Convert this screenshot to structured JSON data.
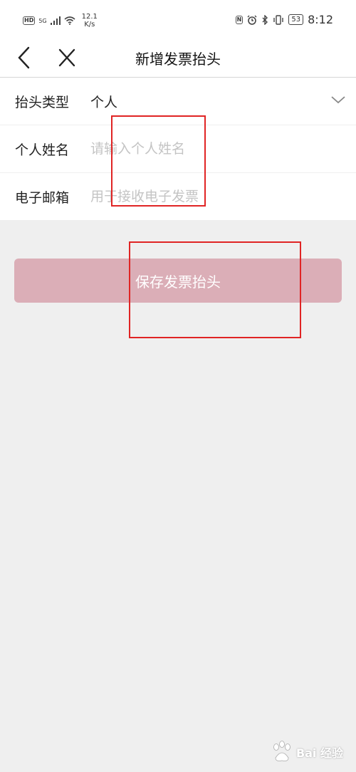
{
  "status_bar": {
    "hd": "HD",
    "network": "5G",
    "speed_value": "12.1",
    "speed_unit": "K/s",
    "nfc": "N",
    "battery": "53",
    "time": "8:12"
  },
  "nav": {
    "title": "新增发票抬头",
    "back_icon": "chevron-left-icon",
    "close_icon": "close-icon"
  },
  "form": {
    "rows": [
      {
        "label": "抬头类型",
        "value": "个人"
      },
      {
        "label": "个人姓名",
        "placeholder": "请输入个人姓名",
        "value": ""
      },
      {
        "label": "电子邮箱",
        "placeholder": "用于接收电子发票",
        "value": ""
      }
    ]
  },
  "save_button": {
    "label": "保存发票抬头",
    "color": "#dbaeb7"
  },
  "watermark": {
    "text": "Bai 经验",
    "icon": "baidu-paw-icon"
  },
  "colors": {
    "background": "#efefef",
    "annotation_red": "#e02424",
    "placeholder": "#c4c4c4"
  }
}
